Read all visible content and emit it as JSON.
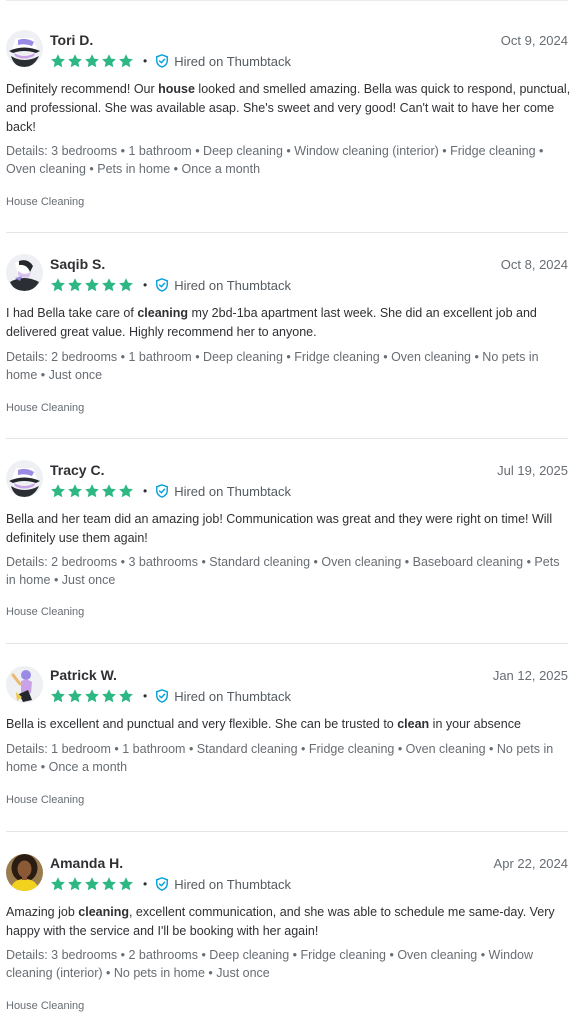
{
  "colors": {
    "star": "#2db783",
    "hired_icon": "#009fd9",
    "divider": "#e2e5e7",
    "muted_text": "#676d73"
  },
  "reviews": [
    {
      "name": "Tori D.",
      "date": "Oct 9, 2024",
      "rating": 5,
      "hired_label": "Hired on Thumbtack",
      "avatar": "hat-woman-avatar",
      "body": [
        {
          "text": "Definitely recommend! Our ",
          "bold": false
        },
        {
          "text": "house",
          "bold": true
        },
        {
          "text": " looked and smelled amazing. Bella was quick to respond, punctual, and professional. She was available asap. She's sweet and very good! Can't wait to have her come back!",
          "bold": false
        }
      ],
      "details": "Details: 3 bedrooms • 1 bathroom • Deep cleaning • Window cleaning (interior) • Fridge cleaning • Oven cleaning • Pets in home • Once a month",
      "category": "House Cleaning"
    },
    {
      "name": "Saqib S.",
      "date": "Oct 8, 2024",
      "rating": 5,
      "hired_label": "Hired on Thumbtack",
      "avatar": "hooded-figure-avatar",
      "body": [
        {
          "text": "I had Bella take care of ",
          "bold": false
        },
        {
          "text": "cleaning",
          "bold": true
        },
        {
          "text": " my 2bd-1ba apartment last week. She did an excellent job and delivered great value. Highly recommend her to anyone.",
          "bold": false
        }
      ],
      "details": "Details: 2 bedrooms • 1 bathroom • Deep cleaning • Fridge cleaning • Oven cleaning • No pets in home • Just once",
      "category": "House Cleaning"
    },
    {
      "name": "Tracy C.",
      "date": "Jul 19, 2025",
      "rating": 5,
      "hired_label": "Hired on Thumbtack",
      "avatar": "hat-woman-avatar",
      "body": [
        {
          "text": "Bella and her team did an amazing job! Communication was great and they were right on time! Will definitely use them again!",
          "bold": false
        }
      ],
      "details": "Details: 2 bedrooms • 3 bathrooms • Standard cleaning • Oven cleaning • Baseboard cleaning • Pets in home • Just once",
      "category": "House Cleaning"
    },
    {
      "name": "Patrick W.",
      "date": "Jan 12, 2025",
      "rating": 5,
      "hired_label": "Hired on Thumbtack",
      "avatar": "waving-figure-avatar",
      "body": [
        {
          "text": "Bella is excellent and punctual and very flexible. She can be trusted to ",
          "bold": false
        },
        {
          "text": "clean",
          "bold": true
        },
        {
          "text": " in your absence",
          "bold": false
        }
      ],
      "details": "Details: 1 bedroom • 1 bathroom • Standard cleaning • Fridge cleaning • Oven cleaning • No pets in home • Once a month",
      "category": "House Cleaning"
    },
    {
      "name": "Amanda H.",
      "date": "Apr 22, 2024",
      "rating": 5,
      "hired_label": "Hired on Thumbtack",
      "avatar": "photo-avatar",
      "body": [
        {
          "text": "Amazing job ",
          "bold": false
        },
        {
          "text": "cleaning",
          "bold": true
        },
        {
          "text": ", excellent communication, and she was able to schedule me same-day. Very happy with the service and I'll be booking with her again!",
          "bold": false
        }
      ],
      "details": "Details: 3 bedrooms • 2 bathrooms • Deep cleaning • Fridge cleaning • Oven cleaning • Window cleaning (interior) • No pets in home • Just once",
      "category": "House Cleaning"
    }
  ]
}
